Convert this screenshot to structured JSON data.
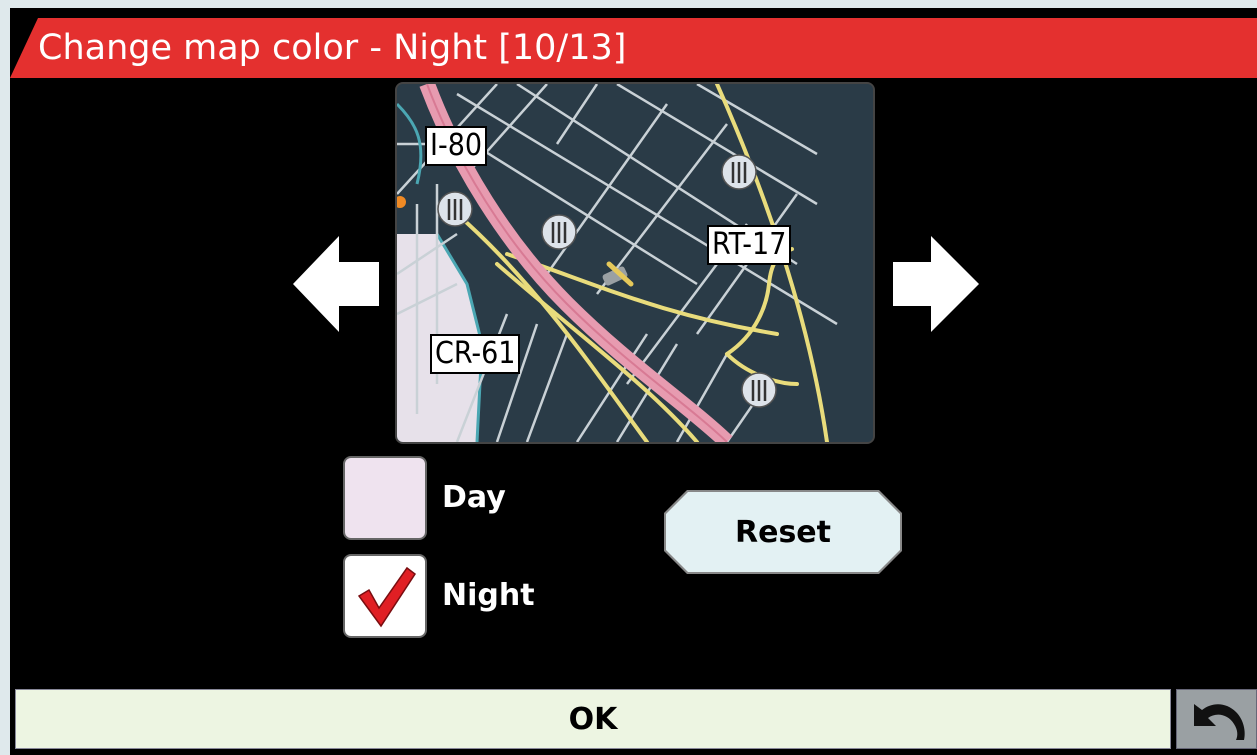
{
  "title": "Change map color - Night [10/13]",
  "map_preview": {
    "labels": [
      "I-80",
      "RT-17",
      "CR-61"
    ]
  },
  "options": {
    "day_label": "Day",
    "night_label": "Night",
    "selected": "Night"
  },
  "buttons": {
    "reset_label": "Reset",
    "ok_label": "OK"
  },
  "icons": {
    "prev": "arrow-left-icon",
    "next": "arrow-right-icon",
    "back": "undo-arrow-icon",
    "check": "checkmark-icon",
    "poi": "restaurant-icon",
    "vehicle": "vehicle-icon"
  },
  "colors": {
    "title_bar": "#e4302f",
    "map_background": "#2a3b47",
    "highway": "#e79bb0",
    "major_road": "#e9dc7c",
    "checkmark": "#e01f24"
  }
}
